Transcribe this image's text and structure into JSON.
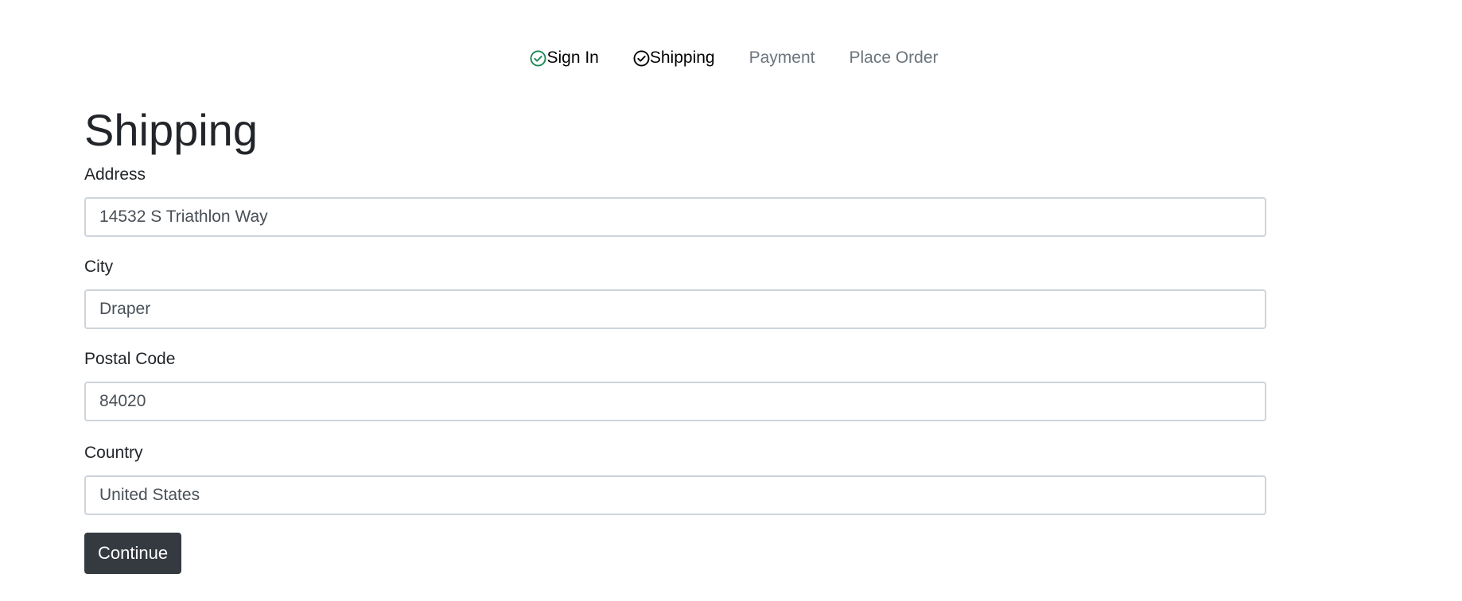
{
  "steps": [
    {
      "label": "Sign In",
      "done": true,
      "icon": "check-circle-icon",
      "icon_color": "#198754"
    },
    {
      "label": "Shipping",
      "done": true,
      "icon": "check-circle-icon",
      "icon_color": "#000000"
    },
    {
      "label": "Payment",
      "done": false
    },
    {
      "label": "Place Order",
      "done": false
    }
  ],
  "page": {
    "title": "Shipping"
  },
  "form": {
    "address": {
      "label": "Address",
      "value": "14532 S Triathlon Way"
    },
    "city": {
      "label": "City",
      "value": "Draper"
    },
    "postal_code": {
      "label": "Postal Code",
      "value": "84020"
    },
    "country": {
      "label": "Country",
      "value": "United States"
    },
    "submit_label": "Continue"
  },
  "colors": {
    "accent_dark": "#343a40",
    "muted": "#6c757d",
    "success": "#198754"
  }
}
